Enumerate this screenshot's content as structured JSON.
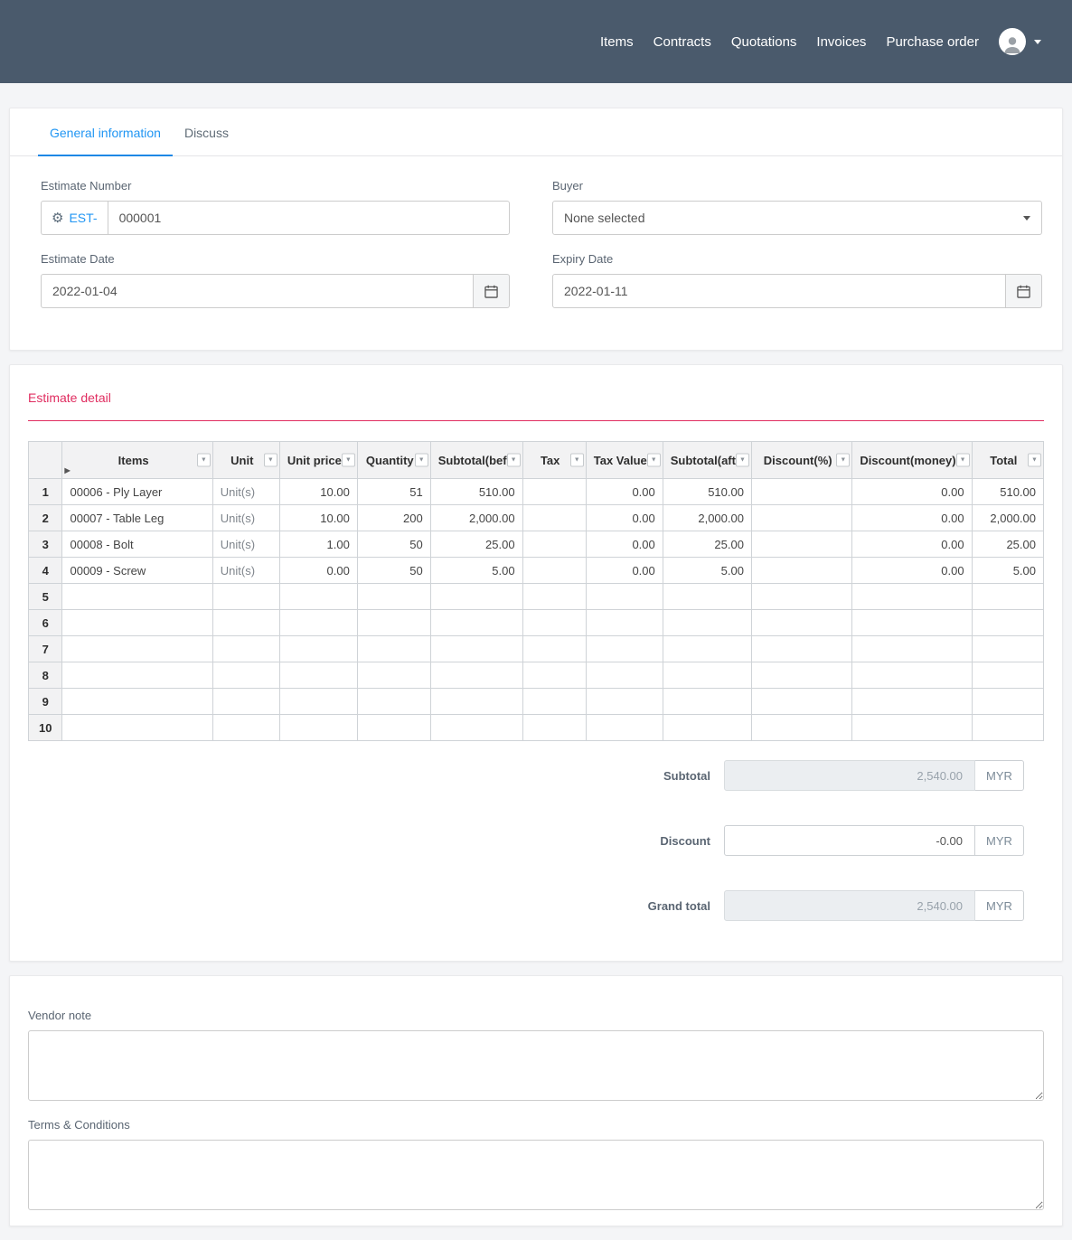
{
  "navbar": {
    "items": [
      {
        "label": "Items"
      },
      {
        "label": "Contracts"
      },
      {
        "label": "Quotations"
      },
      {
        "label": "Invoices"
      },
      {
        "label": "Purchase order"
      }
    ]
  },
  "tabs": {
    "general": "General information",
    "discuss": "Discuss"
  },
  "form": {
    "estimate_number": {
      "label": "Estimate Number",
      "prefix": "EST-",
      "value": "000001"
    },
    "buyer": {
      "label": "Buyer",
      "value": "None selected"
    },
    "estimate_date": {
      "label": "Estimate Date",
      "value": "2022-01-04"
    },
    "expiry_date": {
      "label": "Expiry Date",
      "value": "2022-01-11"
    }
  },
  "detail": {
    "title": "Estimate detail",
    "grid": {
      "columns": [
        {
          "label": "Items"
        },
        {
          "label": "Unit"
        },
        {
          "label": "Unit price"
        },
        {
          "label": "Quantity"
        },
        {
          "label": "Subtotal(bef"
        },
        {
          "label": "Tax"
        },
        {
          "label": "Tax Value"
        },
        {
          "label": "Subtotal(aft"
        },
        {
          "label": "Discount(%)"
        },
        {
          "label": "Discount(money)"
        },
        {
          "label": "Total"
        }
      ],
      "rows": [
        [
          "00006 - Ply Layer",
          "Unit(s)",
          "10.00",
          "51",
          "510.00",
          "",
          "0.00",
          "510.00",
          "",
          "0.00",
          "510.00"
        ],
        [
          "00007 - Table Leg",
          "Unit(s)",
          "10.00",
          "200",
          "2,000.00",
          "",
          "0.00",
          "2,000.00",
          "",
          "0.00",
          "2,000.00"
        ],
        [
          "00008 - Bolt",
          "Unit(s)",
          "1.00",
          "50",
          "25.00",
          "",
          "0.00",
          "25.00",
          "",
          "0.00",
          "25.00"
        ],
        [
          "00009 - Screw",
          "Unit(s)",
          "0.00",
          "50",
          "5.00",
          "",
          "0.00",
          "5.00",
          "",
          "0.00",
          "5.00"
        ],
        [],
        [],
        [],
        [],
        [],
        []
      ]
    },
    "summary": {
      "subtotal": {
        "label": "Subtotal",
        "value": "2,540.00",
        "currency": "MYR"
      },
      "discount": {
        "label": "Discount",
        "value": "-0.00",
        "currency": "MYR"
      },
      "grand_total": {
        "label": "Grand total",
        "value": "2,540.00",
        "currency": "MYR"
      }
    },
    "colors": {
      "accent_red": "#e02d60",
      "accent_blue": "#2196f3",
      "navbar": "#4a5a6c"
    }
  },
  "notes": {
    "vendor_label": "Vendor note",
    "vendor_value": "",
    "terms_label": "Terms & Conditions",
    "terms_value": ""
  }
}
